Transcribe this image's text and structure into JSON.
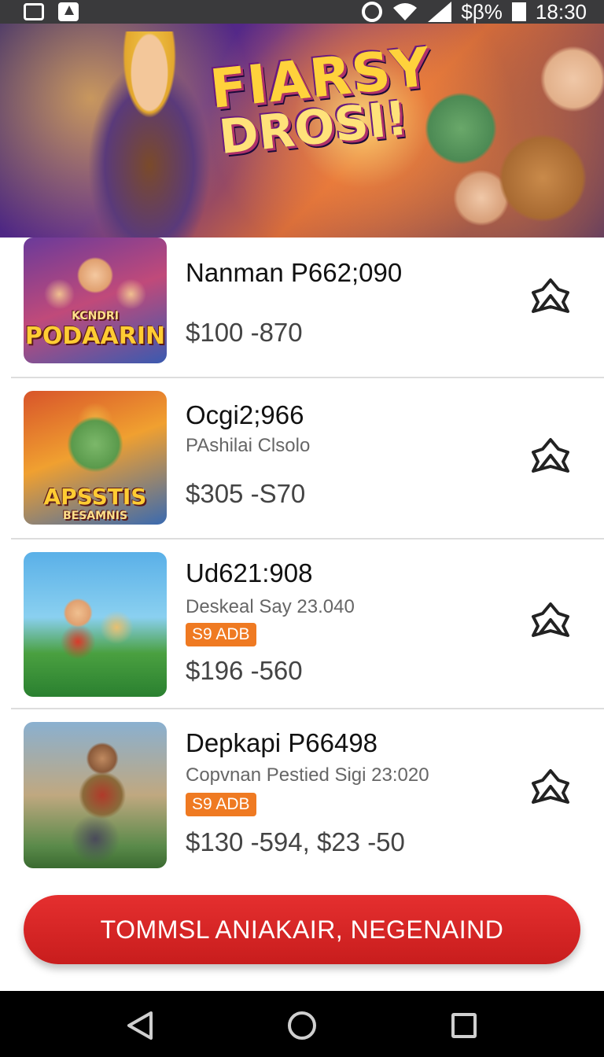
{
  "status_bar": {
    "extra": "$β%",
    "time": "18:30"
  },
  "banner": {
    "title_line1": "FIARSY",
    "title_line2": "DROSI!"
  },
  "items": [
    {
      "title": "Nanman P662;090",
      "subtitle": "",
      "badge": "",
      "price": "$100 -870",
      "thumb_text": "PODAARIN",
      "thumb_text_small": "KCNDRI"
    },
    {
      "title": "Ocgi2;966",
      "subtitle": "PAshilai Clsolo",
      "badge": "",
      "price": "$305 -S70",
      "thumb_text": "APSSTIS",
      "thumb_text_small": "BESAMNIS"
    },
    {
      "title": "Ud621:908",
      "subtitle": "Deskeal Say 23.040",
      "badge": "S9 ADB",
      "price": "$196 -560",
      "thumb_text": "",
      "thumb_text_small": ""
    },
    {
      "title": "Depkapi P66498",
      "subtitle": "Copvnan Pestied Sigi 23:020",
      "badge": "S9 ADB",
      "price": "$130 -594, $23 -50",
      "thumb_text": "",
      "thumb_text_small": ""
    }
  ],
  "cta": {
    "label": "TOMMSL ANIAKAIR, NEGENAIND"
  },
  "icons": {
    "favorite": "favorite-knot-icon",
    "back": "back-triangle-icon",
    "home": "home-circle-icon",
    "recents": "recents-square-icon"
  },
  "colors": {
    "accent": "#d92626",
    "badge": "#ef7a22"
  }
}
